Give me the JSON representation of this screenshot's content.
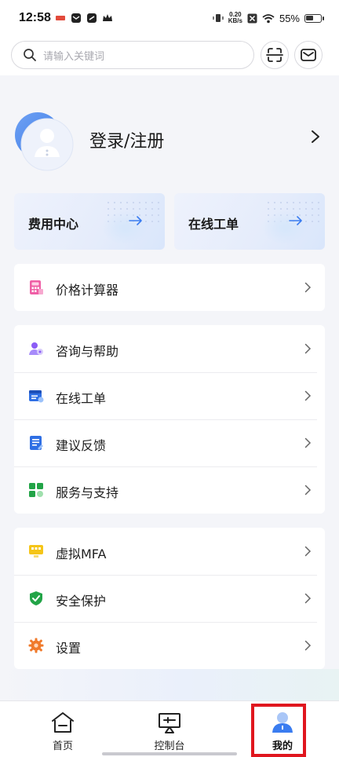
{
  "status_bar": {
    "time": "12:58",
    "net_speed_value": "0.20",
    "net_speed_unit": "KB/s",
    "battery_percent": "55%",
    "battery_level": 0.55
  },
  "search": {
    "placeholder": "请输入关键词"
  },
  "profile": {
    "login_label": "登录/注册"
  },
  "quick_cards": [
    {
      "label": "费用中心"
    },
    {
      "label": "在线工单"
    }
  ],
  "groups": [
    {
      "items": [
        {
          "label": "价格计算器",
          "icon": "calculator-icon"
        }
      ]
    },
    {
      "items": [
        {
          "label": "咨询与帮助",
          "icon": "consult-icon"
        },
        {
          "label": "在线工单",
          "icon": "work-order-icon"
        },
        {
          "label": "建议反馈",
          "icon": "feedback-icon"
        },
        {
          "label": "服务与支持",
          "icon": "service-icon"
        }
      ]
    },
    {
      "items": [
        {
          "label": "虚拟MFA",
          "icon": "mfa-icon"
        },
        {
          "label": "安全保护",
          "icon": "shield-icon"
        },
        {
          "label": "设置",
          "icon": "gear-icon"
        }
      ]
    }
  ],
  "tabs": [
    {
      "label": "首页",
      "icon": "home-icon"
    },
    {
      "label": "控制台",
      "icon": "console-icon"
    },
    {
      "label": "我的",
      "icon": "user-icon",
      "active": true
    }
  ],
  "colors": {
    "accent_blue": "#3a7cf0",
    "highlight_red": "#e0161e"
  }
}
